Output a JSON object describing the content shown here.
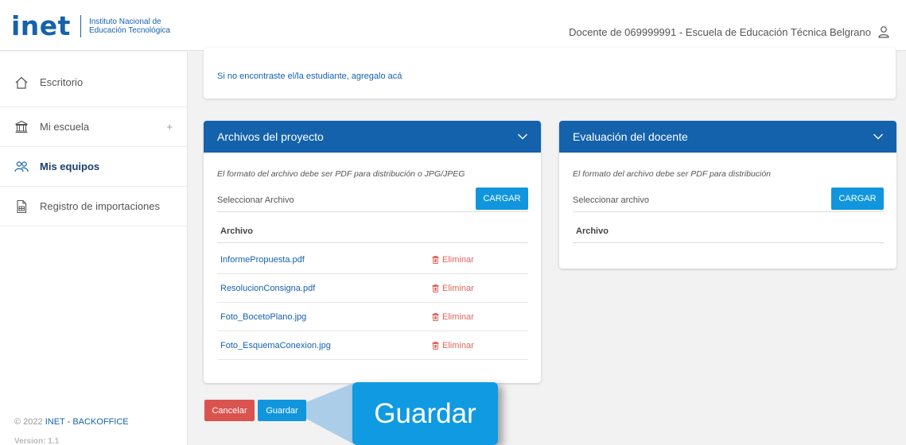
{
  "header": {
    "logo_word": "inet",
    "logo_line1": "Instituto Nacional de",
    "logo_line2": "Educación Tecnológica",
    "user_text": "Docente de 069999991 - Escuela de Educación Técnica Belgrano",
    "user_icon": "user-icon"
  },
  "sidebar": {
    "items": [
      {
        "label": "Escritorio",
        "icon": "home-icon"
      },
      {
        "label": "Mi escuela",
        "icon": "school-icon",
        "expand": "+"
      },
      {
        "label": "Mis equipos",
        "icon": "team-icon"
      },
      {
        "label": "Registro de importaciones",
        "icon": "import-icon"
      }
    ],
    "footer_year": "© 2022",
    "footer_brand": "INET - BACKOFFICE",
    "version": "Version: 1.1"
  },
  "top_card": {
    "link_text": "Si no encontraste el/la estudiante, agregalo acá"
  },
  "archivos_panel": {
    "title": "Archivos del proyecto",
    "format_note": "El formato del archivo debe ser PDF para distribución o JPG/JPEG",
    "select_placeholder": "Seleccionar Archivo",
    "upload_label": "CARGAR",
    "column_header": "Archivo",
    "files": [
      {
        "name": "InformePropuesta.pdf",
        "action": "Eliminar"
      },
      {
        "name": "ResolucionConsigna.pdf",
        "action": "Eliminar"
      },
      {
        "name": "Foto_BocetoPlano.jpg",
        "action": "Eliminar"
      },
      {
        "name": "Foto_EsquemaConexion.jpg",
        "action": "Eliminar"
      }
    ]
  },
  "evaluacion_panel": {
    "title": "Evaluación del docente",
    "format_note": "El formato del archivo debe ser PDF para distribución",
    "select_placeholder": "Seleccionar archivo",
    "upload_label": "CARGAR",
    "column_header": "Archivo"
  },
  "actions": {
    "cancel_label": "Cancelar",
    "save_label": "Guardar"
  },
  "callout": {
    "label": "Guardar"
  },
  "colors": {
    "brand_blue": "#1462ab",
    "button_blue": "#1196dd",
    "danger_red": "#d9534f"
  }
}
